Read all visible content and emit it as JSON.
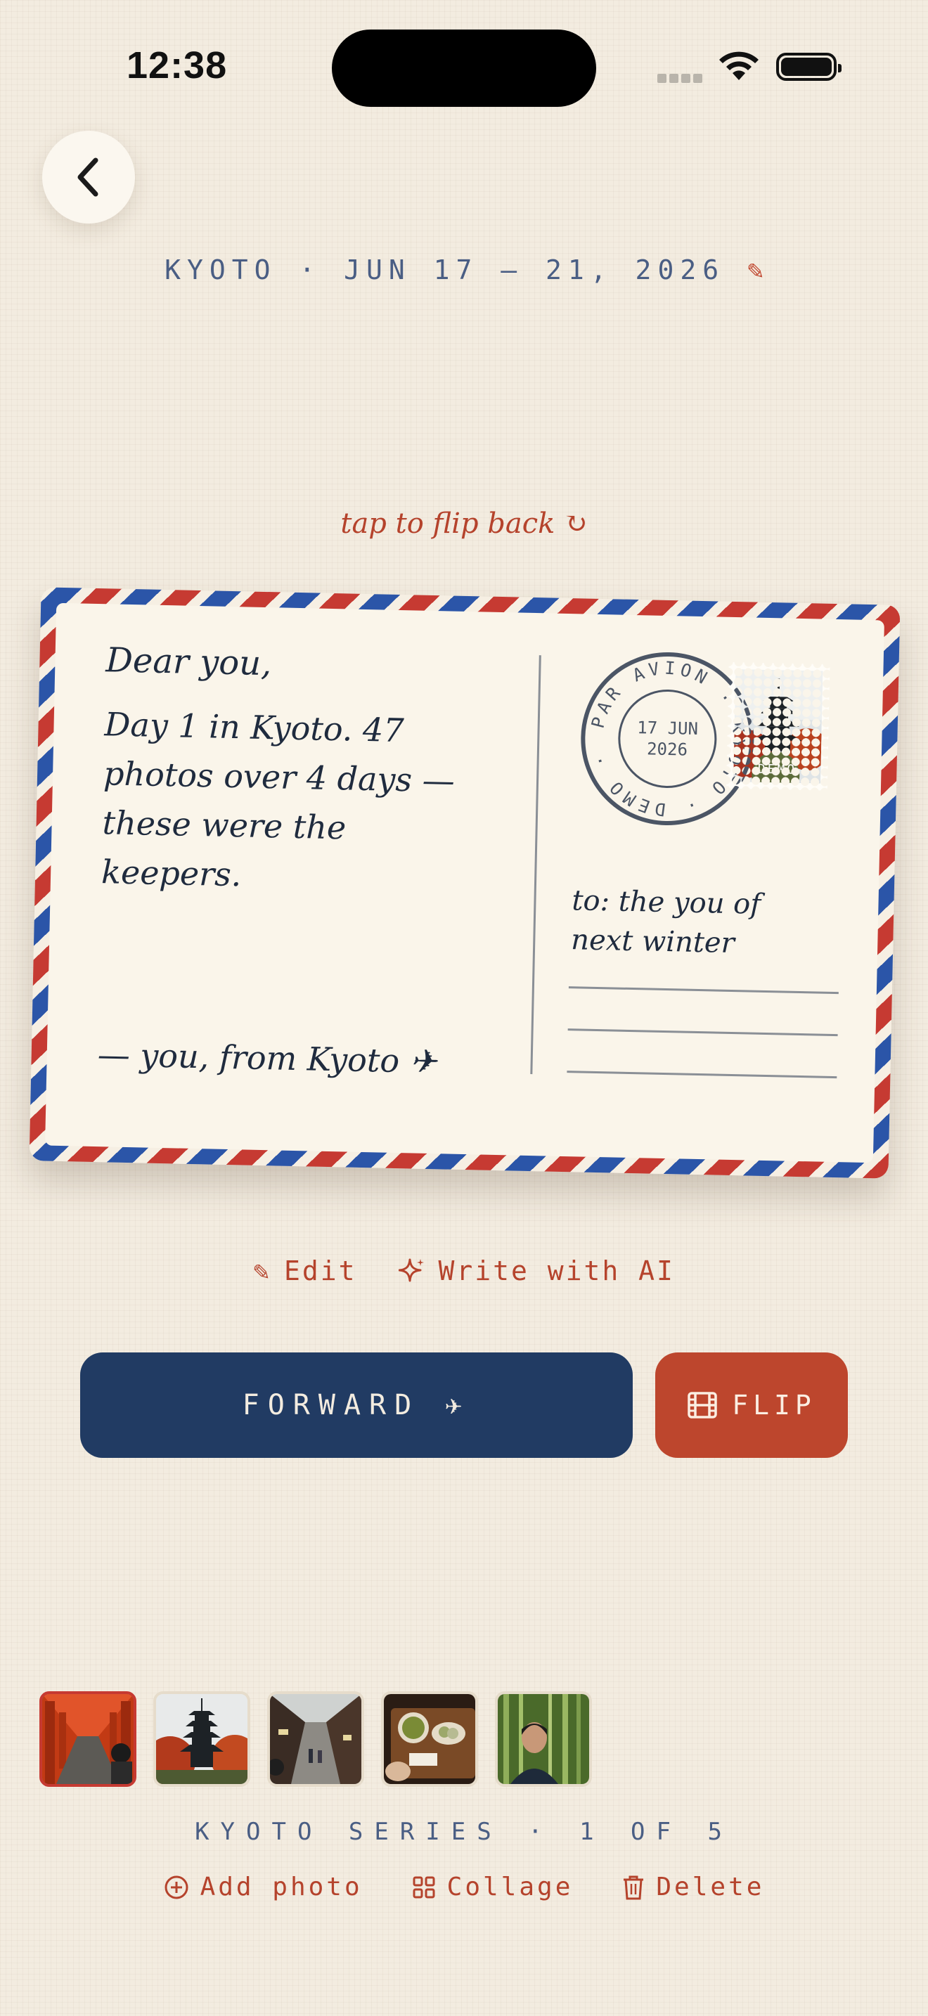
{
  "status_bar": {
    "time": "12:38"
  },
  "header": {
    "trip_title": "KYOTO · JUN 17 — 21, 2026"
  },
  "flip_hint": "tap to flip back ↻",
  "postcard": {
    "greeting": "Dear you,",
    "message_lines": [
      "Day 1 in Kyoto. 47",
      "photos over 4 days —",
      "these were the keepers."
    ],
    "signoff": "— you, from Kyoto ✈",
    "postmark": {
      "ring_text": "PAR AVION · KYOTO · DEMO ·",
      "date_line1": "17 JUN",
      "date_line2": "2026"
    },
    "stamp_label": "DEMO",
    "address_lines": [
      "to: the you of",
      "next winter"
    ]
  },
  "actions": {
    "edit": "Edit",
    "write_ai": "Write with AI"
  },
  "buttons": {
    "forward": "FORWARD ✈",
    "flip": "FLIP"
  },
  "series": {
    "label": "KYOTO SERIES · 1 OF 5",
    "thumbnails": [
      "torii-tunnel",
      "pagoda-autumn",
      "old-street",
      "matcha-tray",
      "bamboo-selfie"
    ]
  },
  "bottom_actions": {
    "add_photo": "Add photo",
    "collage": "Collage",
    "delete": "Delete"
  },
  "colors": {
    "navy": "#213b63",
    "rust": "#bd462d",
    "paper": "#f3ece0",
    "airmail_red": "#c63a32",
    "airmail_blue": "#2b55a8"
  }
}
